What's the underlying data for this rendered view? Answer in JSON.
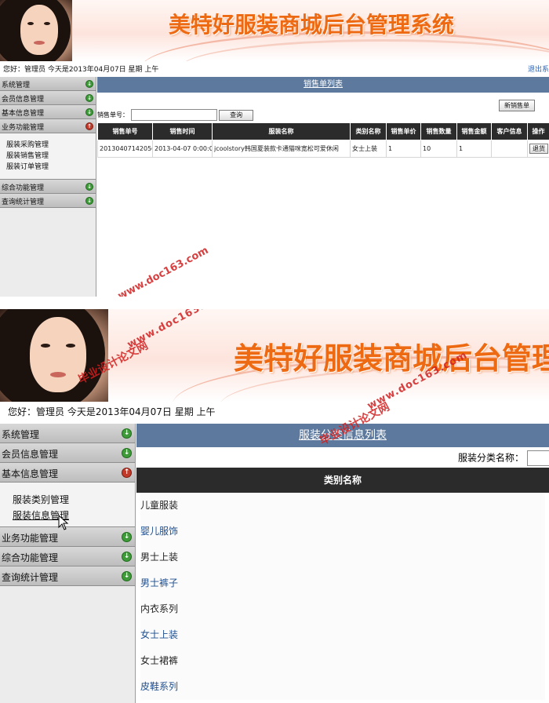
{
  "header": {
    "title": "美特好服装商城后台管理系统",
    "welcome": "您好：管理员    今天是2013年04月07日    星期    上午",
    "logout": "退出系"
  },
  "sidebar": {
    "menu": [
      "系统管理",
      "会员信息管理",
      "基本信息管理",
      "业务功能管理",
      "综合功能管理",
      "查询统计管理"
    ]
  },
  "screen1": {
    "expanded_menu": "业务功能管理",
    "submenu": [
      "服装采购管理",
      "服装销售管理",
      "服装订单管理"
    ],
    "list_title": "销售单列表",
    "new_button": "新销售单",
    "search_label": "销售单号：",
    "search_value": "",
    "search_button": "查询",
    "columns": [
      "销售单号",
      "销售时间",
      "服装名称",
      "类别名称",
      "销售单价",
      "销售数量",
      "销售金额",
      "客户信息",
      "操作"
    ],
    "rows": [
      [
        "20130407142056",
        "2013-04-07 0:00:00",
        "jcoolstory韩国夏装款卡通猫咪宽松可爱休闲",
        "女士上装",
        "1",
        "10",
        "1",
        "",
        "退货"
      ]
    ]
  },
  "screen2": {
    "expanded_menu": "基本信息管理",
    "submenu": [
      "服装类别管理",
      "服装信息管理"
    ],
    "list_title": "服装分类信息列表",
    "search_label": "服装分类名称：",
    "search_value": "",
    "column": "类别名称",
    "categories": [
      "儿童服装",
      "婴儿服饰",
      "男士上装",
      "男士裤子",
      "内衣系列",
      "女士上装",
      "女士裙裤",
      "皮鞋系列"
    ]
  },
  "watermarks": [
    "毕业设计论文网",
    "www.doc163.com"
  ],
  "colors": {
    "title_orange": "#ee6a12",
    "titlebar": "#5d7a9e",
    "table_header": "#2b2b2b",
    "link_blue": "#1f4f8f",
    "watermark": "#d11f1f"
  }
}
